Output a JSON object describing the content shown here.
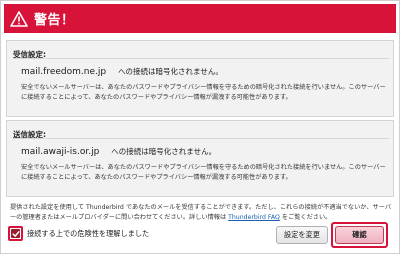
{
  "banner": {
    "title": "警告！",
    "icon": "warning-icon"
  },
  "incoming": {
    "heading": "受信設定:",
    "server": "mail.freedom.ne.jp",
    "message": "への接続は暗号化されません。",
    "description": "安全でないメールサーバーは、あなたのパスワードやプライバシー情報を守るための暗号化された接続を行いません。このサーバーに接続することによって、あなたのパスワードやプライバシー情報が漏洩する可能性があります。"
  },
  "outgoing": {
    "heading": "送信設定:",
    "server": "mail.awaji-is.or.jp",
    "message": "への接続は暗号化されません。",
    "description": "安全でないメールサーバーは、あなたのパスワードやプライバシー情報を守るための暗号化された接続を行いません。このサーバーに接続することによって、あなたのパスワードやプライバシー情報が漏洩する可能性があります。"
  },
  "footer": {
    "text": "提供された設定を使用して Thunderbird であなたのメールを受信することができます。ただし、これらの接続が不適当でないか、サーバーの管理者またはメールプロバイダーに問い合わせてください。詳しい情報は",
    "faq_link": "Thunderbird FAQ",
    "text_end": "をご覧ください。"
  },
  "acknowledge": {
    "label": "接続する上での危険性を理解しました",
    "checked": true
  },
  "buttons": {
    "change_settings": "設定を変更",
    "confirm": "確認"
  },
  "colors": {
    "accent": "#d7133a",
    "link": "#1a5fb4"
  }
}
